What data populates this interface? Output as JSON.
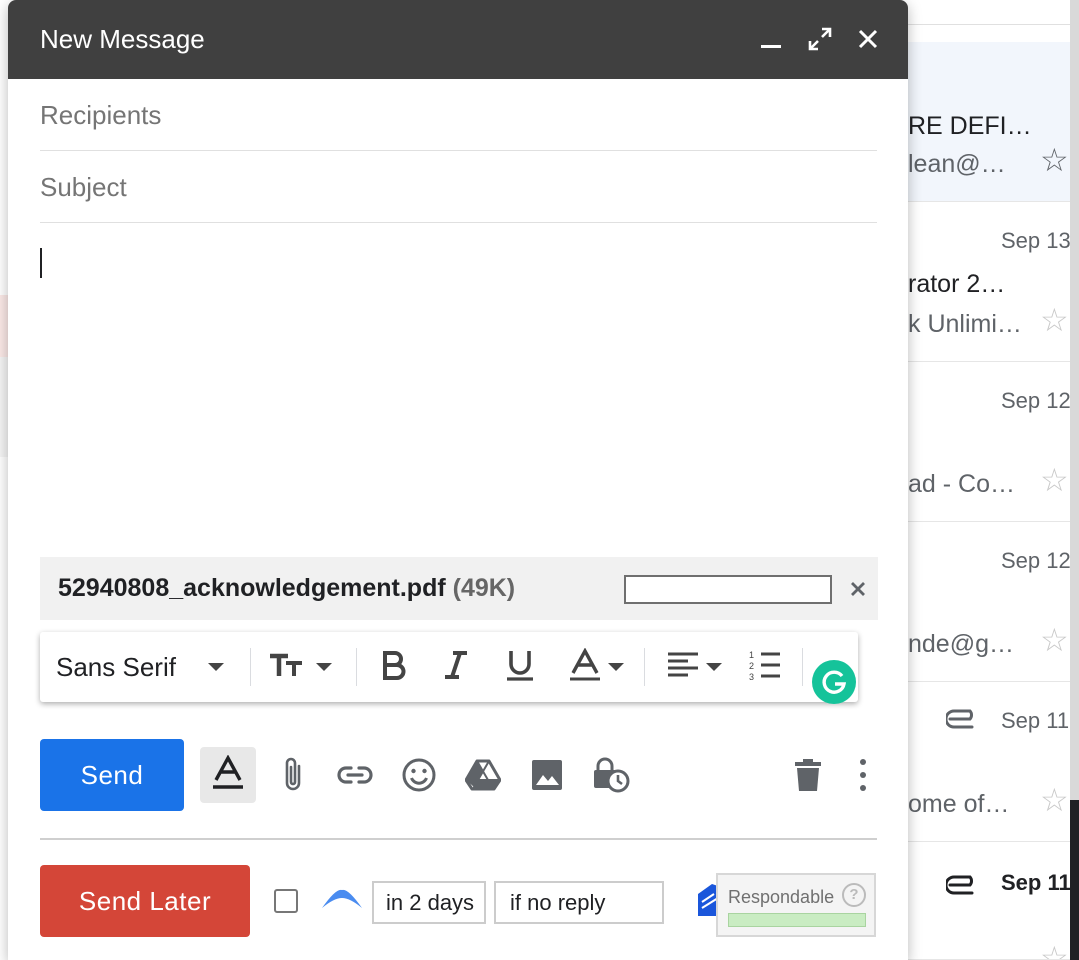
{
  "compose": {
    "title": "New Message",
    "recipients_placeholder": "Recipients",
    "subject_placeholder": "Subject",
    "body": ""
  },
  "attachment": {
    "filename": "52940808_acknowledgement.pdf",
    "size": "(49K)"
  },
  "formatting": {
    "font": "Sans Serif"
  },
  "actions": {
    "send": "Send",
    "send_later": "Send Later",
    "remind_delay": "in 2 days",
    "remind_condition": "if no reply",
    "respondable": "Respondable",
    "respondable_help": "?"
  },
  "inbox_rows": [
    {
      "date": "",
      "line1": "RE DEFI…",
      "line2": "lean@…",
      "star": "☆"
    },
    {
      "date": "Sep 13",
      "line1": "rator 2…",
      "line2": "k Unlimi…",
      "star": "☆"
    },
    {
      "date": "Sep 12",
      "line1": "",
      "line2": "ad - Co…",
      "star": "☆"
    },
    {
      "date": "Sep 12",
      "line1": "",
      "line2": "nde@g…",
      "star": "☆"
    },
    {
      "date": "Sep 11",
      "line1": "",
      "line2": "ome of…",
      "star": "☆"
    },
    {
      "date": "Sep 11",
      "line1": "",
      "line2": "",
      "star": "☆"
    }
  ],
  "colors": {
    "header": "#404040",
    "send": "#1a73e8",
    "send_later": "#d44638",
    "grammarly": "#15c39a",
    "respondable_bar": "#c9ecc2"
  }
}
